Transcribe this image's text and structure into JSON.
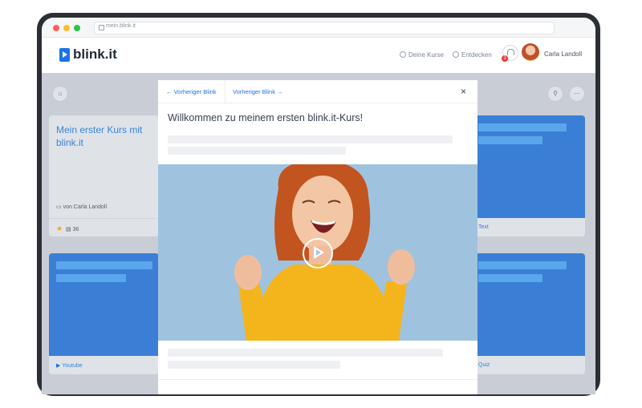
{
  "browser": {
    "url": "mein.blink.it"
  },
  "app": {
    "logo": "blink.it",
    "nav": [
      {
        "label": "Deine Kurse",
        "icon": "home-icon"
      },
      {
        "label": "Entdecken",
        "icon": "compass-icon"
      }
    ],
    "notifications": {
      "count": "3"
    },
    "user": {
      "name": "Carla Landoll"
    }
  },
  "course_card": {
    "title": "Mein erster Kurs mit blink.it",
    "author": "von Carla Landoll",
    "count": "36"
  },
  "cards": {
    "right_top_label": "Text",
    "left_bottom_label": "Youtube",
    "right_bottom_label": "Quiz"
  },
  "modal": {
    "prev_label": "← Vorheriger Blink",
    "next_label": "Vorheriger Blink →",
    "close": "×",
    "title": "Willkommen zu meinem ersten blink.it-Kurs!"
  },
  "colors": {
    "accent": "#1a73e8",
    "card_blue": "#3a7fd5",
    "photo_bg": "#9fc3df",
    "sweater": "#f4b41c"
  }
}
